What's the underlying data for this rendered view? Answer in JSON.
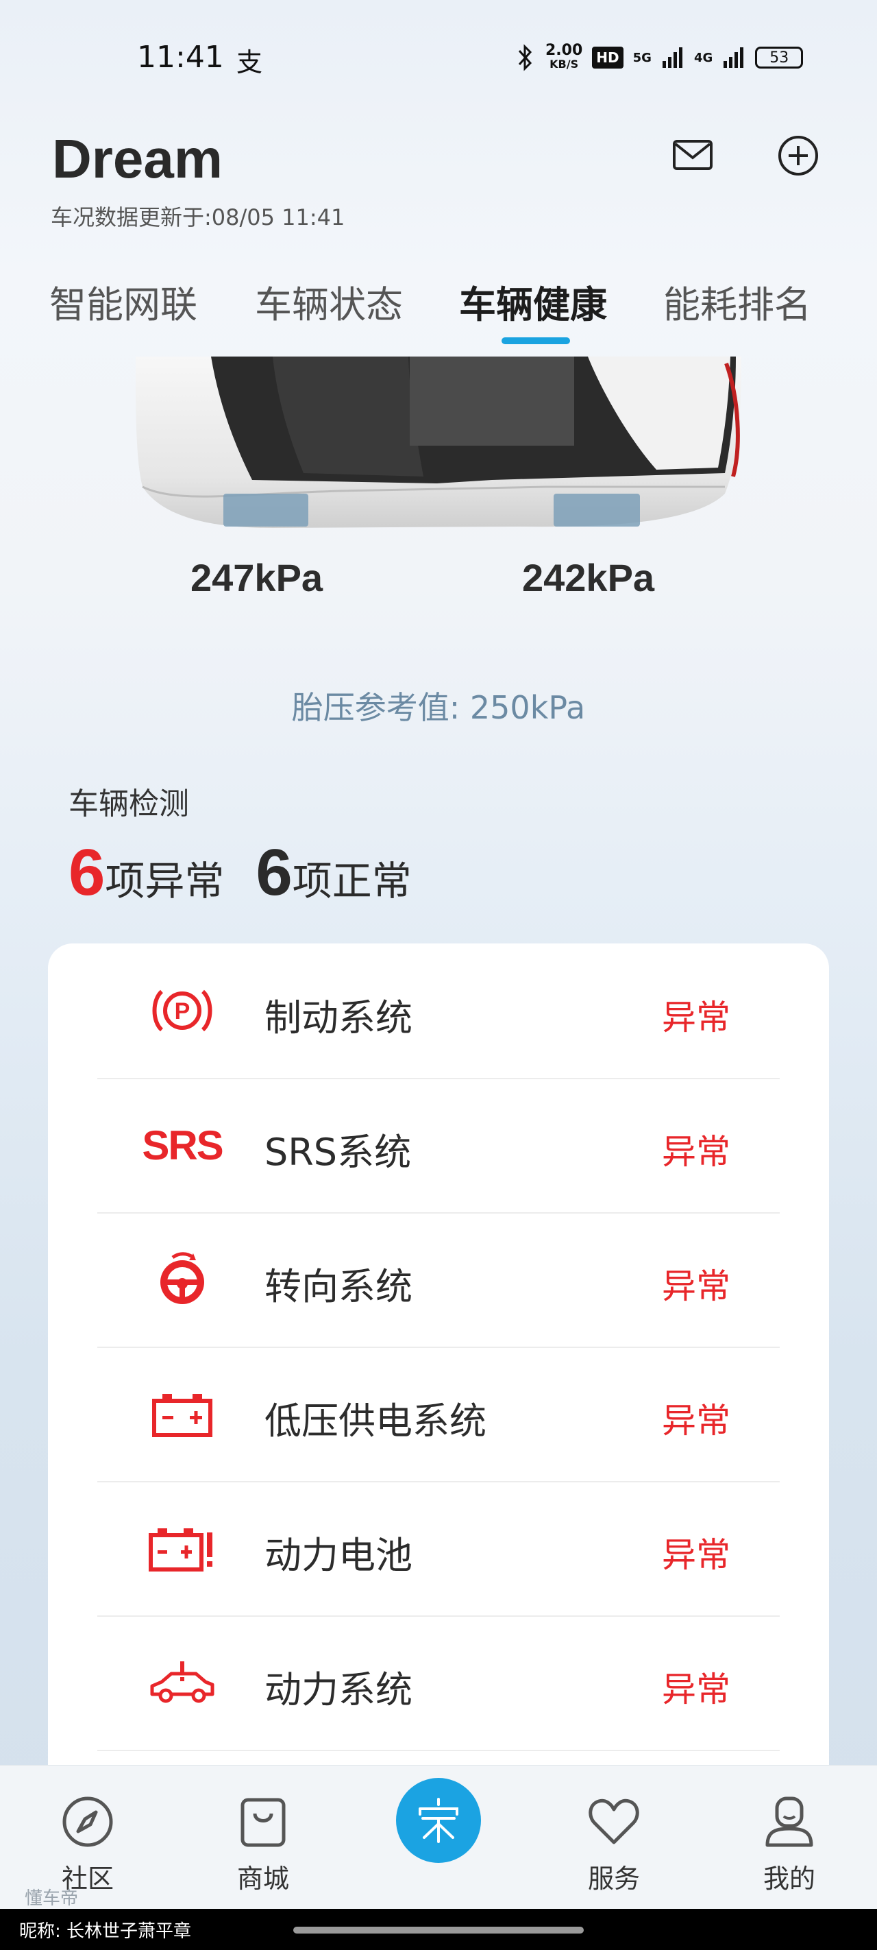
{
  "status_bar": {
    "time": "11:41",
    "alipay": "支",
    "speed_value": "2.00",
    "speed_unit": "KB/S",
    "hd": "HD",
    "net_5g": "5G",
    "net_4g": "4G",
    "battery": "53"
  },
  "header": {
    "title": "Dream",
    "updated": "车况数据更新于:08/05 11:41"
  },
  "tabs": [
    {
      "label": "智能网联",
      "active": false
    },
    {
      "label": "车辆状态",
      "active": false
    },
    {
      "label": "车辆健康",
      "active": true
    },
    {
      "label": "能耗排名",
      "active": false
    }
  ],
  "tires": {
    "left": "247kPa",
    "right": "242kPa",
    "reference": "胎压参考值:  250kPa"
  },
  "detection": {
    "label": "车辆检测",
    "abnormal_count": "6",
    "abnormal_text": "项异常",
    "normal_count": "6",
    "normal_text": "项正常"
  },
  "systems": [
    {
      "label": "制动系统",
      "status": "异常",
      "icon": "parking-brake-icon"
    },
    {
      "label": "SRS系统",
      "status": "异常",
      "icon": "srs-icon",
      "icon_text": "SRS"
    },
    {
      "label": "转向系统",
      "status": "异常",
      "icon": "steering-wheel-icon"
    },
    {
      "label": "低压供电系统",
      "status": "异常",
      "icon": "battery-icon"
    },
    {
      "label": "动力电池",
      "status": "异常",
      "icon": "battery-warning-icon"
    },
    {
      "label": "动力系统",
      "status": "异常",
      "icon": "car-warning-icon"
    }
  ],
  "nav": [
    {
      "label": "社区",
      "icon": "compass-icon"
    },
    {
      "label": "商城",
      "icon": "shopping-bag-icon"
    },
    {
      "label": "",
      "icon": "song-logo-icon"
    },
    {
      "label": "服务",
      "icon": "heart-icon"
    },
    {
      "label": "我的",
      "icon": "profile-icon"
    }
  ],
  "watermark": "懂车帝",
  "caption": "昵称:  长林世子萧平章",
  "colors": {
    "accent": "#1aa3e0",
    "alert": "#e8262a"
  }
}
